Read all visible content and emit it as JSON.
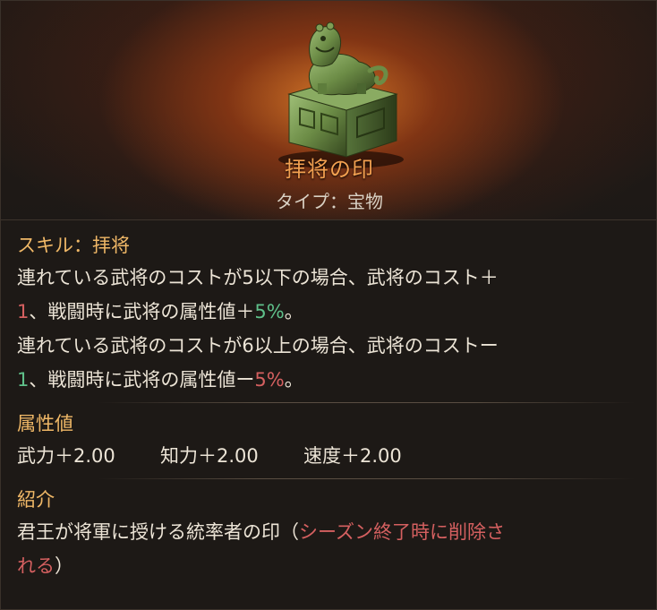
{
  "item": {
    "name": "拝将の印",
    "type_label": "タイプ：宝物"
  },
  "skill": {
    "title": "スキル：拝将",
    "lines": [
      {
        "parts": [
          {
            "text": "連れている武将のコストが5以下の場合、武将のコスト＋",
            "tone": "normal"
          }
        ]
      },
      {
        "parts": [
          {
            "text": "1",
            "tone": "red"
          },
          {
            "text": "、戦闘時に武将の属性値＋",
            "tone": "normal"
          },
          {
            "text": "5%",
            "tone": "green"
          },
          {
            "text": "。",
            "tone": "normal"
          }
        ]
      },
      {
        "parts": [
          {
            "text": "連れている武将のコストが6以上の場合、武将のコストー",
            "tone": "normal"
          }
        ]
      },
      {
        "parts": [
          {
            "text": "1",
            "tone": "green"
          },
          {
            "text": "、戦闘時に武将の属性値ー",
            "tone": "normal"
          },
          {
            "text": "5%",
            "tone": "red"
          },
          {
            "text": "。",
            "tone": "normal"
          }
        ]
      }
    ]
  },
  "attributes": {
    "title": "属性値",
    "items": [
      "武力＋2.00",
      "知力＋2.00",
      "速度＋2.00"
    ]
  },
  "intro": {
    "title": "紹介",
    "line1_prefix": "君王が将軍に授ける統率者の印（",
    "line1_red": "シーズン終了時に削除さ",
    "line2_red": "れる",
    "line2_suffix": "）"
  },
  "colors": {
    "title": "#f2a050",
    "section": "#f0b867",
    "red": "#d56060",
    "green": "#5fc08a",
    "jade": "#6f8e4c"
  },
  "icons": {
    "artwork": "jade-lion-seal-icon"
  }
}
